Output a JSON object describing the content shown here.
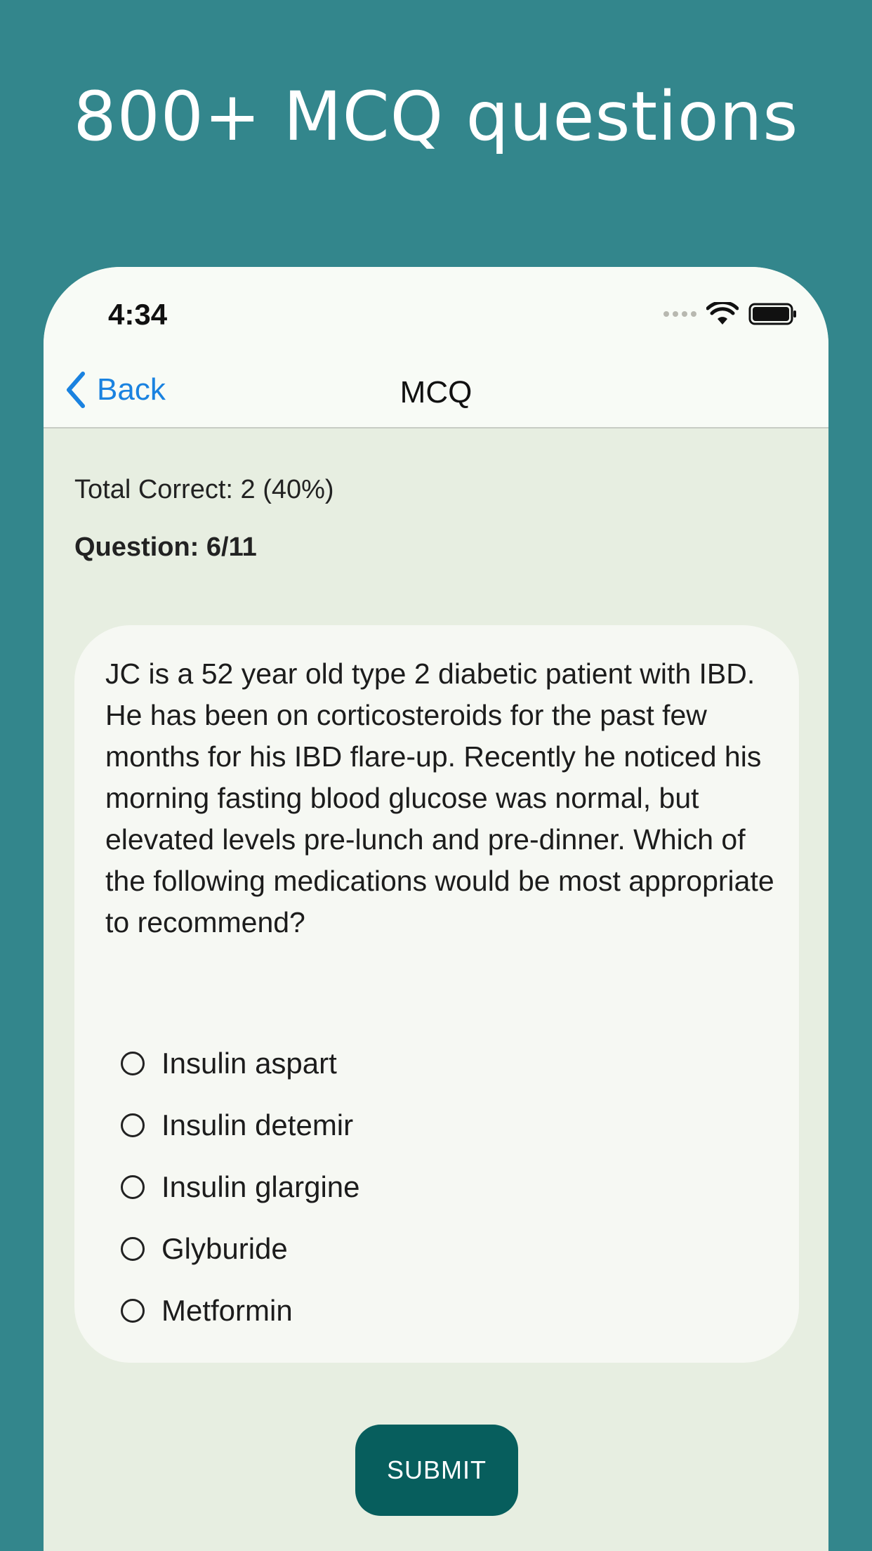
{
  "headline": "800+ MCQ questions",
  "status_bar": {
    "time": "4:34",
    "icons": [
      "cellular-signal-icon",
      "wifi-icon",
      "battery-icon"
    ]
  },
  "nav": {
    "back_label": "Back",
    "title": "MCQ"
  },
  "quiz": {
    "score_text": "Total Correct: 2 (40%)",
    "question_counter": "Question: 6/11",
    "question": "JC is a 52 year old type 2 diabetic patient with IBD. He has been on corticosteroids for the past few months for his IBD flare-up. Recently he noticed his morning fasting blood glucose was normal, but elevated levels pre-lunch and pre-dinner. Which of the following medications would be most appropriate to recommend?",
    "options": [
      "Insulin aspart",
      "Insulin detemir",
      "Insulin glargine",
      "Glyburide",
      "Metformin"
    ],
    "submit_label": "SUBMIT"
  },
  "colors": {
    "background": "#33868c",
    "screen": "#e7eee1",
    "card": "#f6f8f3",
    "accent_link": "#1a82e0",
    "submit_button": "#075e5d"
  }
}
